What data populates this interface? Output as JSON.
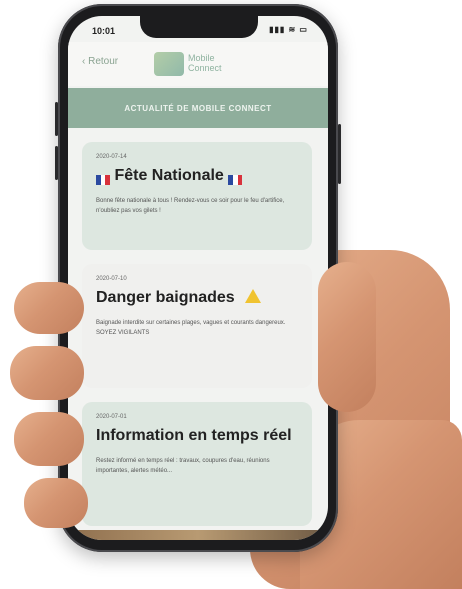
{
  "status_bar": {
    "time": "10:01",
    "signal": "▮▮▮ ≋ ▭"
  },
  "nav": {
    "back_label": "‹ Retour"
  },
  "logo": {
    "line1": "Mobile",
    "line2": "Connect"
  },
  "banner": {
    "title": "ACTUALITÉ DE MOBILE CONNECT"
  },
  "cards": [
    {
      "date": "2020-07-14",
      "title": "Fête Nationale",
      "body": "Bonne fête nationale à tous ! Rendez-vous ce soir pour le feu d'artifice, n'oubliez pas vos gilets !"
    },
    {
      "date": "2020-07-10",
      "title": "Danger baignades",
      "body": "Baignade interdite sur certaines plages, vagues et courants dangereux. SOYEZ VIGILANTS"
    },
    {
      "date": "2020-07-01",
      "title": "Information en temps réel",
      "body": "Restez informé en temps réel : travaux, coupures d'eau, réunions importantes, alertes météo..."
    }
  ],
  "colors": {
    "banner": "#8fae9c",
    "card_tint": "#dde7e0",
    "warning": "#f0c330"
  }
}
